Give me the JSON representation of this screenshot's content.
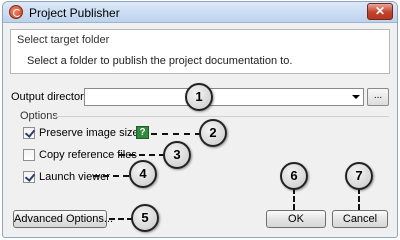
{
  "window": {
    "title": "Project Publisher",
    "close_symbol": "✕"
  },
  "header": {
    "title": "Select target folder",
    "description": "Select a folder to publish the project documentation to."
  },
  "output": {
    "label": "Output directory:",
    "value": "",
    "browse_label": "..."
  },
  "options": {
    "group_label": "Options",
    "items": [
      {
        "label": "Preserve image size",
        "checked": true
      },
      {
        "label": "Copy reference files",
        "checked": false
      },
      {
        "label": "Launch viewer",
        "checked": true
      }
    ],
    "help_symbol": "?"
  },
  "buttons": {
    "advanced": "Advanced Options...",
    "ok": "OK",
    "cancel": "Cancel"
  },
  "callouts": [
    "1",
    "2",
    "3",
    "4",
    "5",
    "6",
    "7"
  ],
  "colors": {
    "help_icon": "#2e8b3c",
    "close_button": "#c4422a",
    "titlebar": "#bcd2ec"
  }
}
